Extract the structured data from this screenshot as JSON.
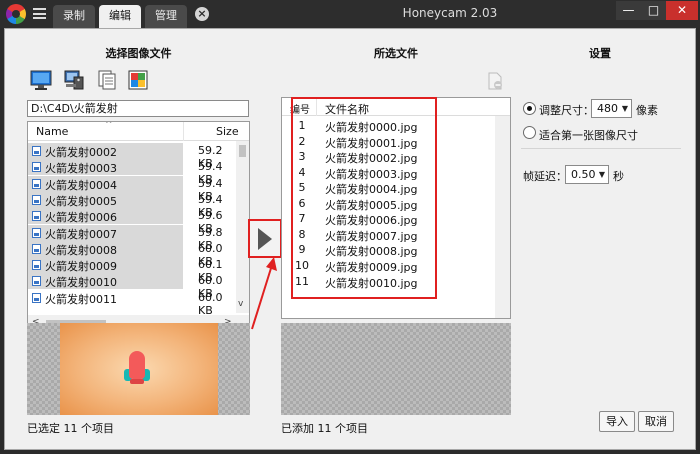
{
  "window": {
    "app_title": "Honeycam 2.03",
    "minimize": "—",
    "maximize": "□",
    "close": "✕"
  },
  "tabs": [
    {
      "label": "录制"
    },
    {
      "label": "编辑"
    },
    {
      "label": "管理"
    }
  ],
  "tab_close": "×",
  "left_panel": {
    "title": "选择图像文件",
    "toolbar_icons": [
      "desktop-icon",
      "computer-icon",
      "documents-icon",
      "images-icon"
    ],
    "path": "D:\\C4D\\火箭发射",
    "columns": {
      "name": "Name",
      "size": "Size"
    },
    "files": [
      {
        "name": "火箭发射0002",
        "size": "59.2 KB"
      },
      {
        "name": "火箭发射0003",
        "size": "59.4 KB"
      },
      {
        "name": "火箭发射0004",
        "size": "59.4 KB"
      },
      {
        "name": "火箭发射0005",
        "size": "59.4 KB"
      },
      {
        "name": "火箭发射0006",
        "size": "59.6 KB"
      },
      {
        "name": "火箭发射0007",
        "size": "59.8 KB"
      },
      {
        "name": "火箭发射0008",
        "size": "60.0 KB"
      },
      {
        "name": "火箭发射0009",
        "size": "60.1 KB"
      },
      {
        "name": "火箭发射0010",
        "size": "60.0 KB"
      },
      {
        "name": "火箭发射0011",
        "size": "60.0 KB"
      }
    ],
    "status": "已选定 11 个项目"
  },
  "selected_panel": {
    "title": "所选文件",
    "columns": {
      "number": "编号",
      "filename": "文件名称"
    },
    "files": [
      {
        "num": "1",
        "name": "火箭发射0000.jpg"
      },
      {
        "num": "2",
        "name": "火箭发射0001.jpg"
      },
      {
        "num": "3",
        "name": "火箭发射0002.jpg"
      },
      {
        "num": "4",
        "name": "火箭发射0003.jpg"
      },
      {
        "num": "5",
        "name": "火箭发射0004.jpg"
      },
      {
        "num": "6",
        "name": "火箭发射0005.jpg"
      },
      {
        "num": "7",
        "name": "火箭发射0006.jpg"
      },
      {
        "num": "8",
        "name": "火箭发射0007.jpg"
      },
      {
        "num": "9",
        "name": "火箭发射0008.jpg"
      },
      {
        "num": "10",
        "name": "火箭发射0009.jpg"
      },
      {
        "num": "11",
        "name": "火箭发射0010.jpg"
      }
    ],
    "status": "已添加 11 个项目"
  },
  "settings": {
    "title": "设置",
    "resize_label": "调整尺寸：",
    "resize_value": "480",
    "resize_unit": "像素",
    "fit_first_label": "适合第一张图像尺寸",
    "delay_label": "帧延迟：",
    "delay_value": "0.50",
    "delay_unit": "秒",
    "import_label": "导入",
    "cancel_label": "取消"
  },
  "colors": {
    "accent_red": "#e02020",
    "titlebar": "#2d2d2d",
    "highlight": "#d9d9d9"
  }
}
